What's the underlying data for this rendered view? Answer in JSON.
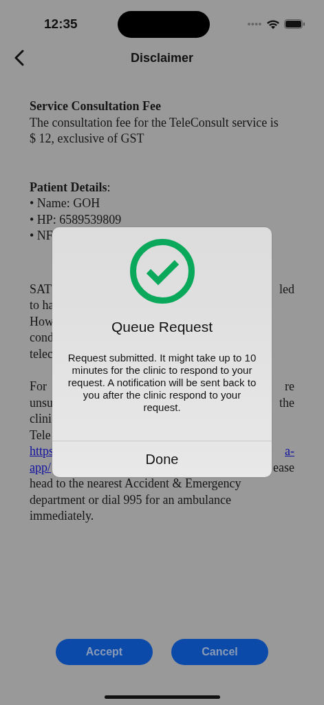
{
  "status_bar": {
    "time": "12:35"
  },
  "nav": {
    "title": "Disclaimer"
  },
  "fee": {
    "heading": "Service Consultation Fee",
    "text": "The consultation fee for the TeleConsult service is $ 12, exclusive of GST"
  },
  "patient": {
    "heading": "**Patient Details**:",
    "items": [
      "• Name: GOH",
      "• HP: 6589539809",
      "• NF"
    ]
  },
  "covered_paragraphs": [
    {
      "lines": [
        {
          "left": {
            "text": "SAT",
            "link": false
          },
          "right": {
            "text": "led",
            "link": false
          }
        },
        {
          "left": {
            "text": "to ha",
            "link": false
          }
        },
        {
          "left": {
            "text": "How",
            "link": false
          }
        },
        {
          "left": {
            "text": "cond",
            "link": false
          }
        },
        {
          "left": {
            "text": "telec",
            "link": false
          }
        }
      ]
    },
    {
      "lines": [
        {
          "left": {
            "text": "For",
            "link": false
          },
          "right": {
            "text": "re",
            "link": false
          }
        },
        {
          "left": {
            "text": "unsu",
            "link": false
          },
          "right": {
            "text": "the",
            "link": false
          }
        },
        {
          "left": {
            "text": "clini",
            "link": false
          }
        },
        {
          "left": {
            "text": "Tele",
            "link": false
          }
        },
        {
          "left": {
            "text": "https",
            "link": true
          },
          "right": {
            "text": "a-",
            "link": true
          }
        },
        {
          "left": {
            "text": "app/",
            "link": true
          },
          "right": {
            "text": "ease",
            "link": false
          }
        }
      ],
      "tail": "head to the nearest Accident & Emergency department or dial 995 for an ambulance immediately."
    }
  ],
  "buttons": [
    {
      "label": "Accept"
    },
    {
      "label": "Cancel"
    }
  ],
  "dialog": {
    "title": "Queue Request",
    "message": "Request submitted. It might take up to 10 minutes for the clinic to respond to your request. A notification will be sent back to you after the clinic respond to your request.",
    "button": "Done"
  }
}
